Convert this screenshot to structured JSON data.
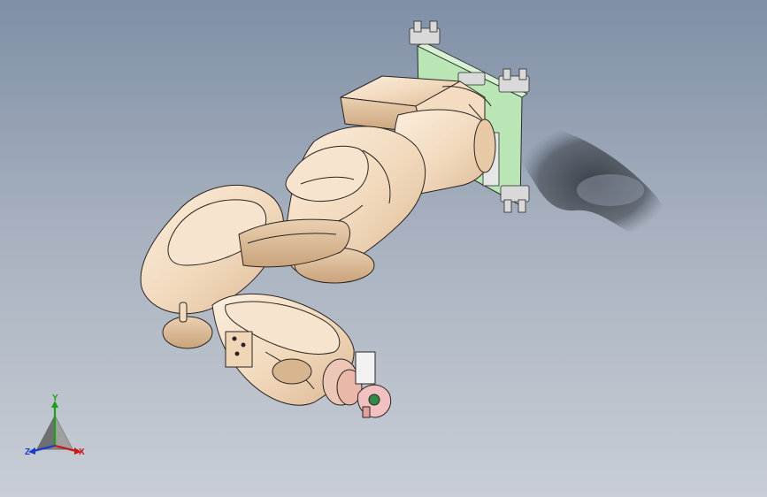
{
  "viewport": {
    "background_top": "#7f8fa6",
    "background_bottom": "#c9ced6",
    "model_color": "#f2dcc2",
    "mount_plate_color": "#b9e6b4"
  },
  "triad": {
    "y_label": "Y",
    "x_label": "X",
    "z_label": "Z",
    "y_color": "#1aa01a",
    "x_color": "#c81818",
    "z_color": "#1a3cc8"
  }
}
